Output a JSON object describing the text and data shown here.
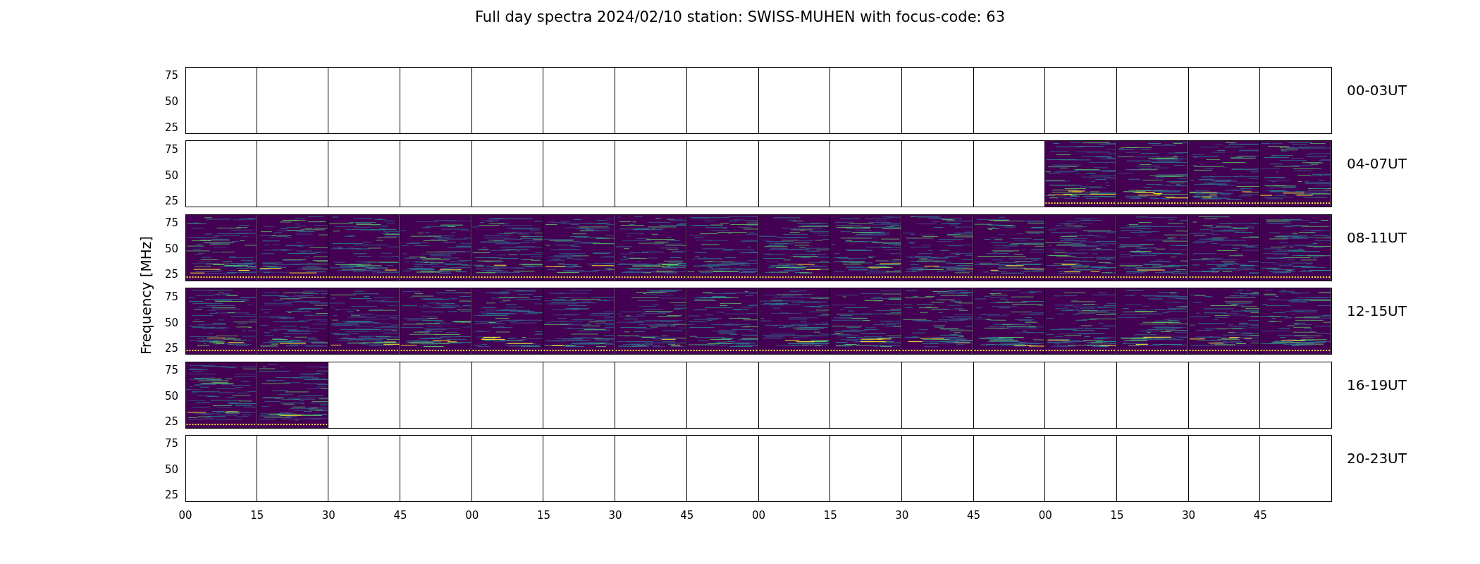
{
  "title": "Full day spectra 2024/02/10 station: SWISS-MUHEN with focus-code: 63",
  "y_axis_label": "Frequency [MHz]",
  "rows": [
    {
      "label": "00-03UT",
      "y_ticks": [
        "75",
        "50",
        "25"
      ],
      "panels": [
        {
          "has_data": false
        },
        {
          "has_data": false
        },
        {
          "has_data": false
        },
        {
          "has_data": false
        },
        {
          "has_data": false
        },
        {
          "has_data": false
        },
        {
          "has_data": false
        },
        {
          "has_data": false
        },
        {
          "has_data": false
        },
        {
          "has_data": false
        },
        {
          "has_data": false
        },
        {
          "has_data": false
        },
        {
          "has_data": false
        },
        {
          "has_data": false
        },
        {
          "has_data": false
        },
        {
          "has_data": false
        }
      ]
    },
    {
      "label": "04-07UT",
      "y_ticks": [
        "75",
        "50",
        "25"
      ],
      "panels": [
        {
          "has_data": false
        },
        {
          "has_data": false
        },
        {
          "has_data": false
        },
        {
          "has_data": false
        },
        {
          "has_data": false
        },
        {
          "has_data": false
        },
        {
          "has_data": false
        },
        {
          "has_data": false
        },
        {
          "has_data": false
        },
        {
          "has_data": false
        },
        {
          "has_data": false
        },
        {
          "has_data": false
        },
        {
          "has_data": true
        },
        {
          "has_data": true
        },
        {
          "has_data": true
        },
        {
          "has_data": true
        }
      ]
    },
    {
      "label": "08-11UT",
      "y_ticks": [
        "75",
        "50",
        "25"
      ],
      "panels": [
        {
          "has_data": true
        },
        {
          "has_data": true
        },
        {
          "has_data": true
        },
        {
          "has_data": true
        },
        {
          "has_data": true
        },
        {
          "has_data": true
        },
        {
          "has_data": true
        },
        {
          "has_data": true
        },
        {
          "has_data": true
        },
        {
          "has_data": true
        },
        {
          "has_data": true
        },
        {
          "has_data": true
        },
        {
          "has_data": true
        },
        {
          "has_data": true
        },
        {
          "has_data": true
        },
        {
          "has_data": true
        }
      ]
    },
    {
      "label": "12-15UT",
      "y_ticks": [
        "75",
        "50",
        "25"
      ],
      "panels": [
        {
          "has_data": true
        },
        {
          "has_data": true
        },
        {
          "has_data": true
        },
        {
          "has_data": true
        },
        {
          "has_data": true
        },
        {
          "has_data": true
        },
        {
          "has_data": true
        },
        {
          "has_data": true
        },
        {
          "has_data": true
        },
        {
          "has_data": true
        },
        {
          "has_data": true
        },
        {
          "has_data": true
        },
        {
          "has_data": true
        },
        {
          "has_data": true
        },
        {
          "has_data": true
        },
        {
          "has_data": true
        }
      ]
    },
    {
      "label": "16-19UT",
      "y_ticks": [
        "75",
        "50",
        "25"
      ],
      "panels": [
        {
          "has_data": true
        },
        {
          "has_data": true
        },
        {
          "has_data": false
        },
        {
          "has_data": false
        },
        {
          "has_data": false
        },
        {
          "has_data": false
        },
        {
          "has_data": false
        },
        {
          "has_data": false
        },
        {
          "has_data": false
        },
        {
          "has_data": false
        },
        {
          "has_data": false
        },
        {
          "has_data": false
        },
        {
          "has_data": false
        },
        {
          "has_data": false
        },
        {
          "has_data": false
        },
        {
          "has_data": false
        }
      ]
    },
    {
      "label": "20-23UT",
      "y_ticks": [
        "75",
        "50",
        "25"
      ],
      "panels": [
        {
          "has_data": false
        },
        {
          "has_data": false
        },
        {
          "has_data": false
        },
        {
          "has_data": false
        },
        {
          "has_data": false
        },
        {
          "has_data": false
        },
        {
          "has_data": false
        },
        {
          "has_data": false
        },
        {
          "has_data": false
        },
        {
          "has_data": false
        },
        {
          "has_data": false
        },
        {
          "has_data": false
        },
        {
          "has_data": false
        },
        {
          "has_data": false
        },
        {
          "has_data": false
        },
        {
          "has_data": false
        }
      ]
    }
  ],
  "x_ticks": [
    "00",
    "15",
    "30",
    "45",
    "00",
    "15",
    "30",
    "45",
    "00",
    "15",
    "30",
    "45",
    "00",
    "15",
    "30",
    "45"
  ]
}
